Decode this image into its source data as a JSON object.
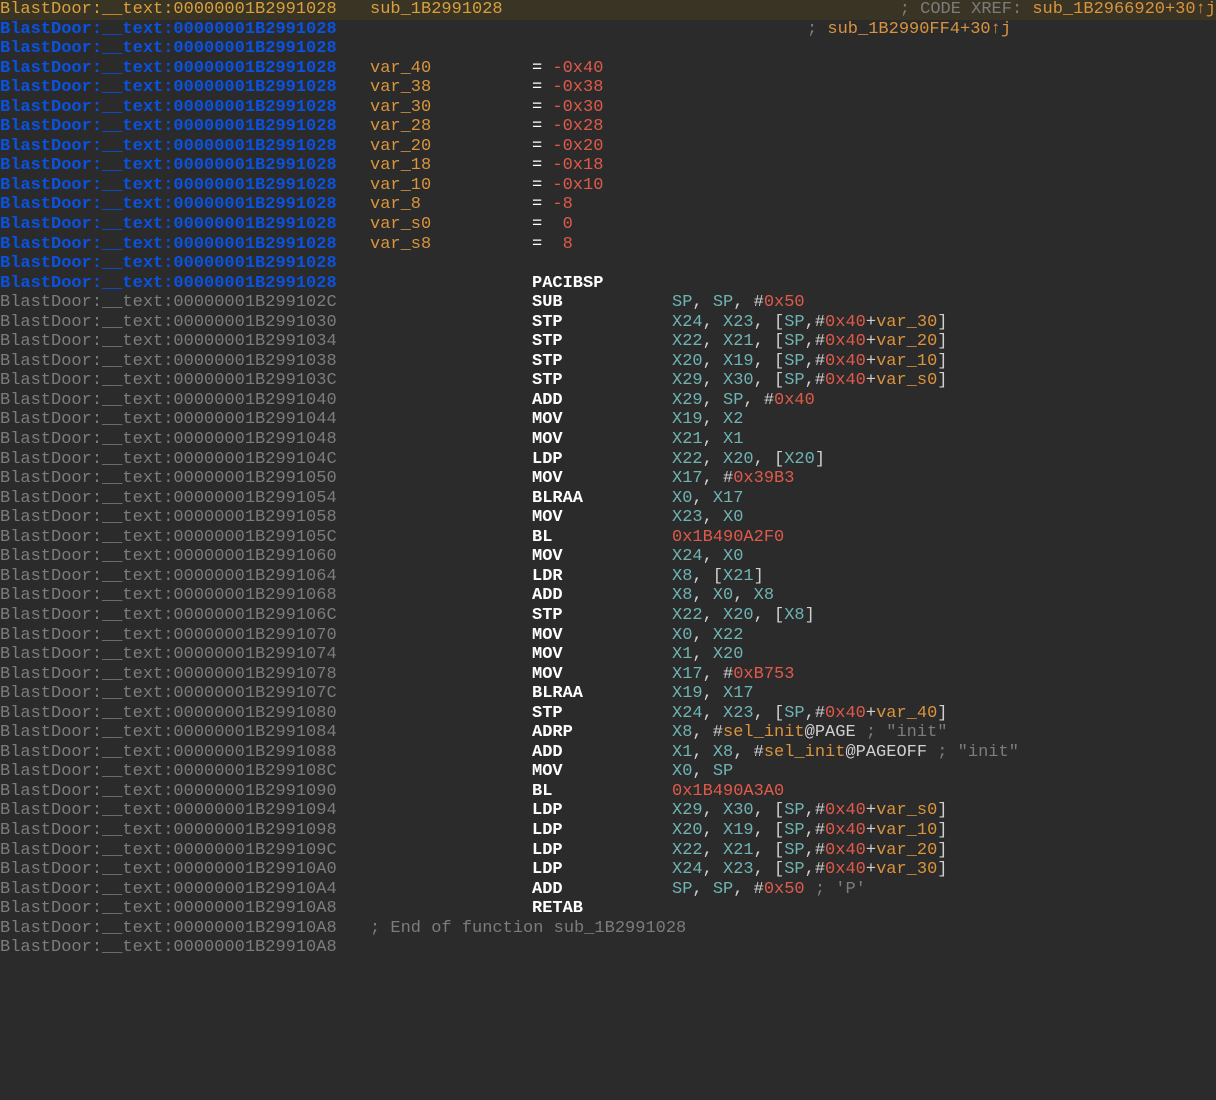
{
  "header": {
    "addr": "BlastDoor:__text:00000001B2991028",
    "sub": "sub_1B2991028",
    "xref1_prefix": "; CODE XREF: ",
    "xref1": "sub_1B2966920+30↑j",
    "xref2_prefix": "; ",
    "xref2": "sub_1B2990FF4+30↑j"
  },
  "blankaddr": "BlastDoor:__text:00000001B2991028",
  "vars": [
    {
      "name": "var_40",
      "eq": "=",
      "val": "-0x40"
    },
    {
      "name": "var_38",
      "eq": "=",
      "val": "-0x38"
    },
    {
      "name": "var_30",
      "eq": "=",
      "val": "-0x30"
    },
    {
      "name": "var_28",
      "eq": "=",
      "val": "-0x28"
    },
    {
      "name": "var_20",
      "eq": "=",
      "val": "-0x20"
    },
    {
      "name": "var_18",
      "eq": "=",
      "val": "-0x18"
    },
    {
      "name": "var_10",
      "eq": "=",
      "val": "-0x10"
    },
    {
      "name": "var_8",
      "eq": "=",
      "val": "-8"
    },
    {
      "name": "var_s0",
      "eq": "=",
      "val": " 0"
    },
    {
      "name": "var_s8",
      "eq": "=",
      "val": " 8"
    }
  ],
  "instrs": [
    {
      "addr": "00000001B2991028",
      "blue": true,
      "mnem": "PACIBSP",
      "args": []
    },
    {
      "addr": "00000001B299102C",
      "mnem": "SUB",
      "args": [
        {
          "t": "reg",
          "v": "SP"
        },
        {
          "t": "p",
          "v": ", "
        },
        {
          "t": "reg",
          "v": "SP"
        },
        {
          "t": "p",
          "v": ", #"
        },
        {
          "t": "hex",
          "v": "0x50"
        }
      ]
    },
    {
      "addr": "00000001B2991030",
      "mnem": "STP",
      "args": [
        {
          "t": "reg",
          "v": "X24"
        },
        {
          "t": "p",
          "v": ", "
        },
        {
          "t": "reg",
          "v": "X23"
        },
        {
          "t": "p",
          "v": ", ["
        },
        {
          "t": "reg",
          "v": "SP"
        },
        {
          "t": "p",
          "v": ",#"
        },
        {
          "t": "hex",
          "v": "0x40"
        },
        {
          "t": "p",
          "v": "+"
        },
        {
          "t": "var",
          "v": "var_30"
        },
        {
          "t": "p",
          "v": "]"
        }
      ]
    },
    {
      "addr": "00000001B2991034",
      "mnem": "STP",
      "args": [
        {
          "t": "reg",
          "v": "X22"
        },
        {
          "t": "p",
          "v": ", "
        },
        {
          "t": "reg",
          "v": "X21"
        },
        {
          "t": "p",
          "v": ", ["
        },
        {
          "t": "reg",
          "v": "SP"
        },
        {
          "t": "p",
          "v": ",#"
        },
        {
          "t": "hex",
          "v": "0x40"
        },
        {
          "t": "p",
          "v": "+"
        },
        {
          "t": "var",
          "v": "var_20"
        },
        {
          "t": "p",
          "v": "]"
        }
      ]
    },
    {
      "addr": "00000001B2991038",
      "mnem": "STP",
      "args": [
        {
          "t": "reg",
          "v": "X20"
        },
        {
          "t": "p",
          "v": ", "
        },
        {
          "t": "reg",
          "v": "X19"
        },
        {
          "t": "p",
          "v": ", ["
        },
        {
          "t": "reg",
          "v": "SP"
        },
        {
          "t": "p",
          "v": ",#"
        },
        {
          "t": "hex",
          "v": "0x40"
        },
        {
          "t": "p",
          "v": "+"
        },
        {
          "t": "var",
          "v": "var_10"
        },
        {
          "t": "p",
          "v": "]"
        }
      ]
    },
    {
      "addr": "00000001B299103C",
      "mnem": "STP",
      "args": [
        {
          "t": "reg",
          "v": "X29"
        },
        {
          "t": "p",
          "v": ", "
        },
        {
          "t": "reg",
          "v": "X30"
        },
        {
          "t": "p",
          "v": ", ["
        },
        {
          "t": "reg",
          "v": "SP"
        },
        {
          "t": "p",
          "v": ",#"
        },
        {
          "t": "hex",
          "v": "0x40"
        },
        {
          "t": "p",
          "v": "+"
        },
        {
          "t": "var",
          "v": "var_s0"
        },
        {
          "t": "p",
          "v": "]"
        }
      ]
    },
    {
      "addr": "00000001B2991040",
      "mnem": "ADD",
      "args": [
        {
          "t": "reg",
          "v": "X29"
        },
        {
          "t": "p",
          "v": ", "
        },
        {
          "t": "reg",
          "v": "SP"
        },
        {
          "t": "p",
          "v": ", #"
        },
        {
          "t": "hex",
          "v": "0x40"
        }
      ]
    },
    {
      "addr": "00000001B2991044",
      "mnem": "MOV",
      "args": [
        {
          "t": "reg",
          "v": "X19"
        },
        {
          "t": "p",
          "v": ", "
        },
        {
          "t": "reg",
          "v": "X2"
        }
      ]
    },
    {
      "addr": "00000001B2991048",
      "mnem": "MOV",
      "args": [
        {
          "t": "reg",
          "v": "X21"
        },
        {
          "t": "p",
          "v": ", "
        },
        {
          "t": "reg",
          "v": "X1"
        }
      ]
    },
    {
      "addr": "00000001B299104C",
      "mnem": "LDP",
      "args": [
        {
          "t": "reg",
          "v": "X22"
        },
        {
          "t": "p",
          "v": ", "
        },
        {
          "t": "reg",
          "v": "X20"
        },
        {
          "t": "p",
          "v": ", ["
        },
        {
          "t": "reg",
          "v": "X20"
        },
        {
          "t": "p",
          "v": "]"
        }
      ]
    },
    {
      "addr": "00000001B2991050",
      "mnem": "MOV",
      "args": [
        {
          "t": "reg",
          "v": "X17"
        },
        {
          "t": "p",
          "v": ", #"
        },
        {
          "t": "hex",
          "v": "0x39B3"
        }
      ]
    },
    {
      "addr": "00000001B2991054",
      "mnem": "BLRAA",
      "args": [
        {
          "t": "reg",
          "v": "X0"
        },
        {
          "t": "p",
          "v": ", "
        },
        {
          "t": "reg",
          "v": "X17"
        }
      ]
    },
    {
      "addr": "00000001B2991058",
      "mnem": "MOV",
      "args": [
        {
          "t": "reg",
          "v": "X23"
        },
        {
          "t": "p",
          "v": ", "
        },
        {
          "t": "reg",
          "v": "X0"
        }
      ]
    },
    {
      "addr": "00000001B299105C",
      "mnem": "BL",
      "args": [
        {
          "t": "branch",
          "v": "0x1B490A2F0"
        }
      ]
    },
    {
      "addr": "00000001B2991060",
      "mnem": "MOV",
      "args": [
        {
          "t": "reg",
          "v": "X24"
        },
        {
          "t": "p",
          "v": ", "
        },
        {
          "t": "reg",
          "v": "X0"
        }
      ]
    },
    {
      "addr": "00000001B2991064",
      "mnem": "LDR",
      "args": [
        {
          "t": "reg",
          "v": "X8"
        },
        {
          "t": "p",
          "v": ", ["
        },
        {
          "t": "reg",
          "v": "X21"
        },
        {
          "t": "p",
          "v": "]"
        }
      ]
    },
    {
      "addr": "00000001B2991068",
      "mnem": "ADD",
      "args": [
        {
          "t": "reg",
          "v": "X8"
        },
        {
          "t": "p",
          "v": ", "
        },
        {
          "t": "reg",
          "v": "X0"
        },
        {
          "t": "p",
          "v": ", "
        },
        {
          "t": "reg",
          "v": "X8"
        }
      ]
    },
    {
      "addr": "00000001B299106C",
      "mnem": "STP",
      "args": [
        {
          "t": "reg",
          "v": "X22"
        },
        {
          "t": "p",
          "v": ", "
        },
        {
          "t": "reg",
          "v": "X20"
        },
        {
          "t": "p",
          "v": ", ["
        },
        {
          "t": "reg",
          "v": "X8"
        },
        {
          "t": "p",
          "v": "]"
        }
      ]
    },
    {
      "addr": "00000001B2991070",
      "mnem": "MOV",
      "args": [
        {
          "t": "reg",
          "v": "X0"
        },
        {
          "t": "p",
          "v": ", "
        },
        {
          "t": "reg",
          "v": "X22"
        }
      ]
    },
    {
      "addr": "00000001B2991074",
      "mnem": "MOV",
      "args": [
        {
          "t": "reg",
          "v": "X1"
        },
        {
          "t": "p",
          "v": ", "
        },
        {
          "t": "reg",
          "v": "X20"
        }
      ]
    },
    {
      "addr": "00000001B2991078",
      "mnem": "MOV",
      "args": [
        {
          "t": "reg",
          "v": "X17"
        },
        {
          "t": "p",
          "v": ", #"
        },
        {
          "t": "hex",
          "v": "0xB753"
        }
      ]
    },
    {
      "addr": "00000001B299107C",
      "mnem": "BLRAA",
      "args": [
        {
          "t": "reg",
          "v": "X19"
        },
        {
          "t": "p",
          "v": ", "
        },
        {
          "t": "reg",
          "v": "X17"
        }
      ]
    },
    {
      "addr": "00000001B2991080",
      "mnem": "STP",
      "args": [
        {
          "t": "reg",
          "v": "X24"
        },
        {
          "t": "p",
          "v": ", "
        },
        {
          "t": "reg",
          "v": "X23"
        },
        {
          "t": "p",
          "v": ", ["
        },
        {
          "t": "reg",
          "v": "SP"
        },
        {
          "t": "p",
          "v": ",#"
        },
        {
          "t": "hex",
          "v": "0x40"
        },
        {
          "t": "p",
          "v": "+"
        },
        {
          "t": "var",
          "v": "var_40"
        },
        {
          "t": "p",
          "v": "]"
        }
      ]
    },
    {
      "addr": "00000001B2991084",
      "mnem": "ADRP",
      "args": [
        {
          "t": "reg",
          "v": "X8"
        },
        {
          "t": "p",
          "v": ", #"
        },
        {
          "t": "sel",
          "v": "sel_init"
        },
        {
          "t": "p",
          "v": "@PAGE "
        },
        {
          "t": "cmt",
          "v": "; \"init\""
        }
      ]
    },
    {
      "addr": "00000001B2991088",
      "mnem": "ADD",
      "args": [
        {
          "t": "reg",
          "v": "X1"
        },
        {
          "t": "p",
          "v": ", "
        },
        {
          "t": "reg",
          "v": "X8"
        },
        {
          "t": "p",
          "v": ", #"
        },
        {
          "t": "sel",
          "v": "sel_init"
        },
        {
          "t": "p",
          "v": "@PAGEOFF "
        },
        {
          "t": "cmt",
          "v": "; \"init\""
        }
      ]
    },
    {
      "addr": "00000001B299108C",
      "mnem": "MOV",
      "args": [
        {
          "t": "reg",
          "v": "X0"
        },
        {
          "t": "p",
          "v": ", "
        },
        {
          "t": "reg",
          "v": "SP"
        }
      ]
    },
    {
      "addr": "00000001B2991090",
      "mnem": "BL",
      "args": [
        {
          "t": "branch",
          "v": "0x1B490A3A0"
        }
      ]
    },
    {
      "addr": "00000001B2991094",
      "mnem": "LDP",
      "args": [
        {
          "t": "reg",
          "v": "X29"
        },
        {
          "t": "p",
          "v": ", "
        },
        {
          "t": "reg",
          "v": "X30"
        },
        {
          "t": "p",
          "v": ", ["
        },
        {
          "t": "reg",
          "v": "SP"
        },
        {
          "t": "p",
          "v": ",#"
        },
        {
          "t": "hex",
          "v": "0x40"
        },
        {
          "t": "p",
          "v": "+"
        },
        {
          "t": "var",
          "v": "var_s0"
        },
        {
          "t": "p",
          "v": "]"
        }
      ]
    },
    {
      "addr": "00000001B2991098",
      "mnem": "LDP",
      "args": [
        {
          "t": "reg",
          "v": "X20"
        },
        {
          "t": "p",
          "v": ", "
        },
        {
          "t": "reg",
          "v": "X19"
        },
        {
          "t": "p",
          "v": ", ["
        },
        {
          "t": "reg",
          "v": "SP"
        },
        {
          "t": "p",
          "v": ",#"
        },
        {
          "t": "hex",
          "v": "0x40"
        },
        {
          "t": "p",
          "v": "+"
        },
        {
          "t": "var",
          "v": "var_10"
        },
        {
          "t": "p",
          "v": "]"
        }
      ]
    },
    {
      "addr": "00000001B299109C",
      "mnem": "LDP",
      "args": [
        {
          "t": "reg",
          "v": "X22"
        },
        {
          "t": "p",
          "v": ", "
        },
        {
          "t": "reg",
          "v": "X21"
        },
        {
          "t": "p",
          "v": ", ["
        },
        {
          "t": "reg",
          "v": "SP"
        },
        {
          "t": "p",
          "v": ",#"
        },
        {
          "t": "hex",
          "v": "0x40"
        },
        {
          "t": "p",
          "v": "+"
        },
        {
          "t": "var",
          "v": "var_20"
        },
        {
          "t": "p",
          "v": "]"
        }
      ]
    },
    {
      "addr": "00000001B29910A0",
      "mnem": "LDP",
      "args": [
        {
          "t": "reg",
          "v": "X24"
        },
        {
          "t": "p",
          "v": ", "
        },
        {
          "t": "reg",
          "v": "X23"
        },
        {
          "t": "p",
          "v": ", ["
        },
        {
          "t": "reg",
          "v": "SP"
        },
        {
          "t": "p",
          "v": ",#"
        },
        {
          "t": "hex",
          "v": "0x40"
        },
        {
          "t": "p",
          "v": "+"
        },
        {
          "t": "var",
          "v": "var_30"
        },
        {
          "t": "p",
          "v": "]"
        }
      ]
    },
    {
      "addr": "00000001B29910A4",
      "mnem": "ADD",
      "args": [
        {
          "t": "reg",
          "v": "SP"
        },
        {
          "t": "p",
          "v": ", "
        },
        {
          "t": "reg",
          "v": "SP"
        },
        {
          "t": "p",
          "v": ", #"
        },
        {
          "t": "hex",
          "v": "0x50"
        },
        {
          "t": "p",
          "v": " "
        },
        {
          "t": "cmt",
          "v": "; 'P'"
        }
      ]
    },
    {
      "addr": "00000001B29910A8",
      "mnem": "RETAB",
      "args": []
    }
  ],
  "endfunc": {
    "addr": "BlastDoor:__text:00000001B29910A8",
    "text": "; End of function sub_1B2991028"
  },
  "tailaddr": "BlastDoor:__text:00000001B29910A8"
}
